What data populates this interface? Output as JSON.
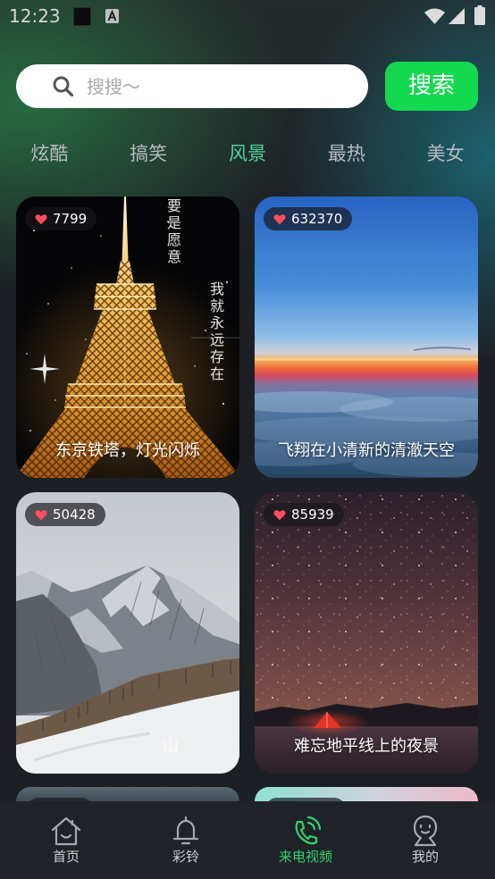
{
  "status_bar": {
    "time": "12:23",
    "left_icons": [
      "square-icon",
      "a-icon"
    ],
    "right_icons": [
      "wifi-icon",
      "signal-icon",
      "battery-icon"
    ]
  },
  "search": {
    "icon": "search-icon",
    "placeholder": "搜搜～",
    "button_label": "搜索"
  },
  "tabs": [
    {
      "label": "炫酷",
      "active": false
    },
    {
      "label": "搞笑",
      "active": false
    },
    {
      "label": "风景",
      "active": true
    },
    {
      "label": "最热",
      "active": false
    },
    {
      "label": "美女",
      "active": false
    }
  ],
  "like_icon": "heart-icon",
  "cards": [
    {
      "likes": "7799",
      "caption": "东京铁塔，灯光闪烁",
      "image_text": [
        "要是愿意",
        "我就永远存在"
      ]
    },
    {
      "likes": "632370",
      "caption": "飞翔在小清新的清澈天空"
    },
    {
      "likes": "50428",
      "caption": "山"
    },
    {
      "likes": "85939",
      "caption": "难忘地平线上的夜景"
    }
  ],
  "bottom_nav": [
    {
      "label": "首页",
      "icon": "home-icon",
      "active": false
    },
    {
      "label": "彩铃",
      "icon": "bell-icon",
      "active": false
    },
    {
      "label": "来电视频",
      "icon": "phone-call-icon",
      "active": true
    },
    {
      "label": "我的",
      "icon": "user-icon",
      "active": false
    }
  ],
  "colors": {
    "accent": "#14d850",
    "tab_active": "#4cd49e",
    "nav_active": "#33d16c",
    "like": "#ff4d5e",
    "background": "#1b1e23"
  }
}
